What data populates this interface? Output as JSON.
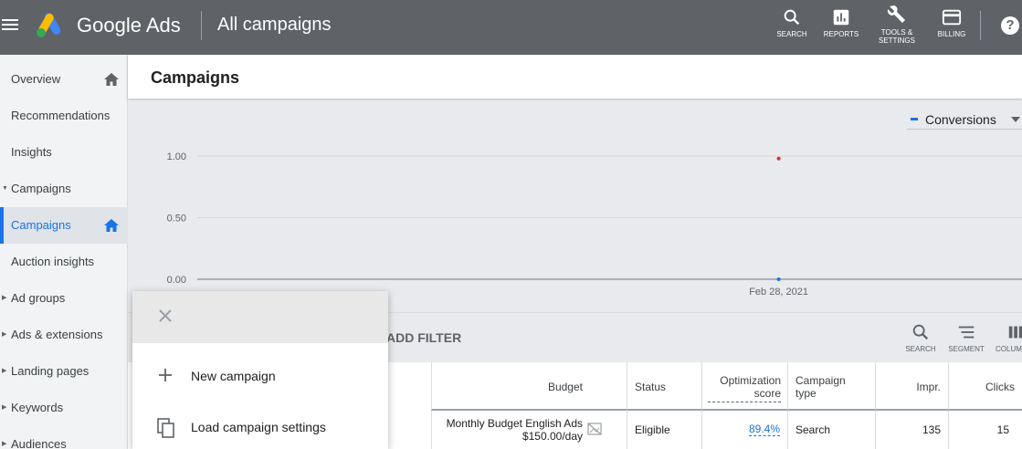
{
  "app": {
    "brand": "Google Ads",
    "page_heading": "All campaigns"
  },
  "toolbar": {
    "search_label": "SEARCH",
    "reports_label": "REPORTS",
    "tools_label_1": "TOOLS &",
    "tools_label_2": "SETTINGS",
    "billing_label": "BILLING",
    "help_label": "?"
  },
  "sidebar": {
    "items": [
      {
        "label": "Overview"
      },
      {
        "label": "Recommendations"
      },
      {
        "label": "Insights"
      },
      {
        "label": "Campaigns"
      },
      {
        "label": "Campaigns"
      },
      {
        "label": "Auction insights"
      },
      {
        "label": "Ad groups"
      },
      {
        "label": "Ads & extensions"
      },
      {
        "label": "Landing pages"
      },
      {
        "label": "Keywords"
      },
      {
        "label": "Audiences"
      }
    ]
  },
  "main": {
    "title": "Campaigns",
    "metric_select": "Conversions"
  },
  "chart_data": {
    "type": "line",
    "title": "",
    "xlabel": "",
    "ylabel": "",
    "y_ticks": [
      "1.00",
      "0.50",
      "0.00"
    ],
    "ylim": [
      0,
      1
    ],
    "x_ticks": [
      "Feb 28, 2021"
    ],
    "series": [
      {
        "color": "#1a73e8",
        "points": [
          {
            "x": "Feb 28, 2021",
            "y": 0
          }
        ]
      },
      {
        "color": "#d93025",
        "points": [
          {
            "x": "Feb 28, 2021",
            "y": 0.98
          }
        ]
      }
    ],
    "grid": true
  },
  "filter_bar": {
    "add_filter": "ADD FILTER",
    "search": "SEARCH",
    "segment": "SEGMENT",
    "columns": "COLUM"
  },
  "table": {
    "headers": {
      "budget": "Budget",
      "status": "Status",
      "opt_score_1": "Optimization",
      "opt_score_2": "score",
      "type_1": "Campaign",
      "type_2": "type",
      "impr": "Impr.",
      "clicks": "Clicks"
    },
    "row": {
      "budget_1": "Monthly Budget English Ads",
      "budget_2": "$150.00/day",
      "status": "Eligible",
      "opt_score": "89.4%",
      "type": "Search",
      "impr": "135",
      "clicks": "15"
    }
  },
  "popup": {
    "items": [
      {
        "label": "New campaign"
      },
      {
        "label": "Load campaign settings"
      }
    ]
  },
  "colors": {
    "topbar": "#5f6368",
    "accent": "#1a73e8",
    "red_point": "#d93025"
  }
}
